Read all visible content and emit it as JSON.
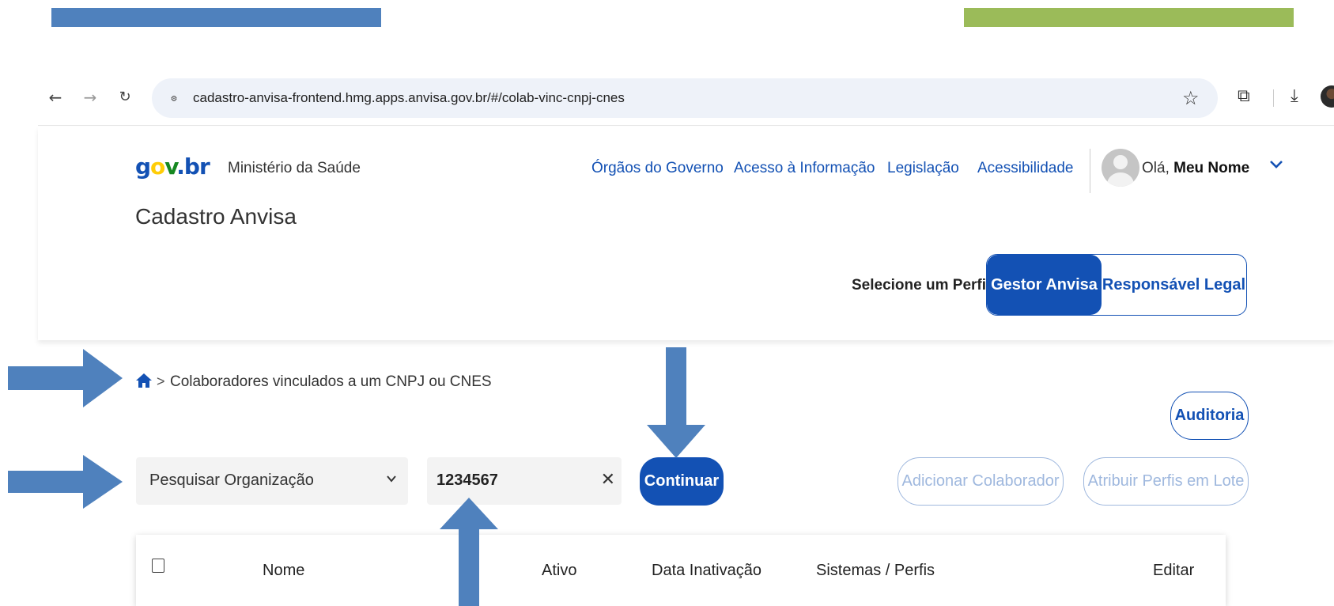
{
  "browser": {
    "url": "cadastro-anvisa-frontend.hmg.apps.anvisa.gov.br/#/colab-vinc-cnpj-cnes"
  },
  "header": {
    "ministry": "Ministério da Saúde",
    "links": [
      "Órgãos do Governo",
      "Acesso à Informação",
      "Legislação",
      "Acessibilidade"
    ],
    "greeting_prefix": "Olá,",
    "user_name": "Meu Nome",
    "app_title": "Cadastro Anvisa",
    "perfil_label": "Selecione um Perfil:",
    "perfis": [
      "Gestor Anvisa",
      "Responsável Legal"
    ],
    "perfil_selected": "Gestor Anvisa"
  },
  "breadcrumb": {
    "separator": ">",
    "current": "Colaboradores vinculados a um CNPJ ou CNES"
  },
  "actions": {
    "auditoria": "Auditoria",
    "adicionar": "Adicionar Colaborador",
    "atribuir": "Atribuir Perfis em Lote",
    "continuar": "Continuar"
  },
  "search": {
    "select_value": "Pesquisar Organização",
    "input_value": "1234567"
  },
  "table": {
    "columns": [
      "Nome",
      "Ativo",
      "Data Inativação",
      "Sistemas / Perfis",
      "Editar"
    ]
  },
  "colors": {
    "primary": "#1351b4",
    "annotation_arrow": "#4f81bd",
    "bar_blue": "#4f81bd",
    "bar_green": "#9bbb59"
  }
}
